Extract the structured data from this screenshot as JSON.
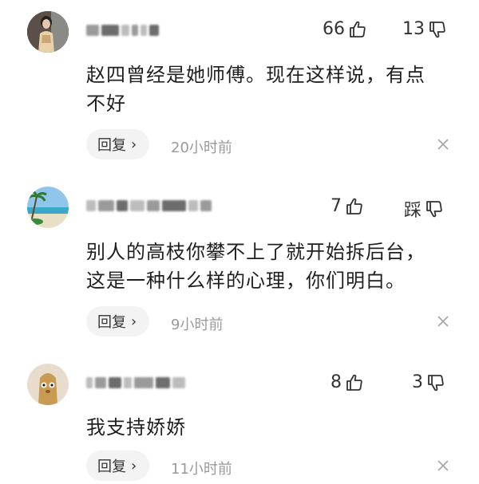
{
  "comments": [
    {
      "likes": "66",
      "dislikes": "13",
      "text_line1": "赵四曾经是她师傅。现在这样说，有点",
      "text_line2": "不好",
      "reply_label": "回复",
      "time": "20小时前",
      "avatar_icon": "woman-portrait-avatar",
      "dislike_label": ""
    },
    {
      "likes": "7",
      "dislikes": "踩",
      "text_line1": "别人的高枝你攀不上了就开始拆后台，",
      "text_line2": "这是一种什么样的心理，你们明白。",
      "reply_label": "回复",
      "time": "9小时前",
      "avatar_icon": "palm-beach-avatar"
    },
    {
      "likes": "8",
      "dislikes": "3",
      "text_line1": "我支持娇娇",
      "text_line2": "",
      "reply_label": "回复",
      "time": "11小时前",
      "avatar_icon": "cartoon-character-avatar"
    }
  ],
  "icons": {
    "like": "thumbs-up-icon",
    "dislike": "thumbs-down-icon",
    "reply_chevron": "chevron-right-icon",
    "close": "close-icon"
  },
  "colors": {
    "text": "#1f1f1f",
    "meta": "#9a9a9a",
    "reply_bg": "#f3f3f3"
  }
}
